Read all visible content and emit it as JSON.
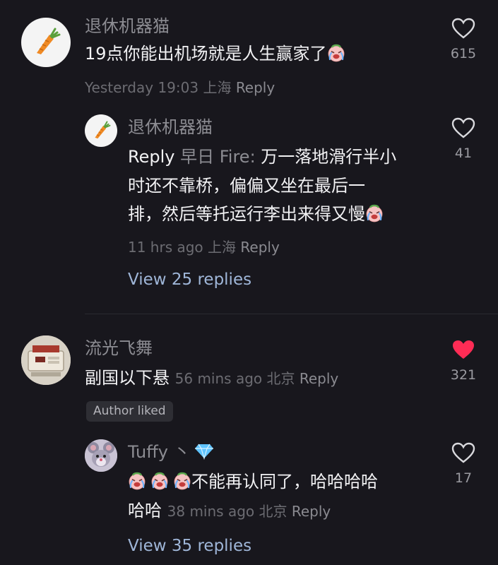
{
  "comments": [
    {
      "username": "退休机器猫",
      "text": "19点你能出机场就是人生赢家了",
      "time": "Yesterday 19:03",
      "location": "上海",
      "reply_label": "Reply",
      "likes": "615",
      "liked": false,
      "avatar": "carrot-icon",
      "replies": [
        {
          "username": "退休机器猫",
          "reply_prefix": "Reply",
          "reply_to": "早日 Fire:",
          "lines": [
            "万一落地滑行半小",
            "时还不靠桥，偏偏又坐在最后一",
            "排，然后等托运行李出来得又慢"
          ],
          "time": "11 hrs ago",
          "location": "上海",
          "reply_label": "Reply",
          "likes": "41",
          "avatar": "carrot-icon"
        }
      ],
      "view_replies": "View 25 replies"
    },
    {
      "username": "流光飞舞",
      "text": "副国以下悬",
      "time": "56 mins ago",
      "location": "北京",
      "reply_label": "Reply",
      "likes": "321",
      "liked": true,
      "liked_color": "#fe2c55",
      "badge": "Author liked",
      "avatar": "console-icon",
      "replies": [
        {
          "username": "Tuffy",
          "name_suffix": "丶",
          "badge_icon": "diamond-icon",
          "lines": [
            "不能再认同了，哈哈哈哈",
            "哈哈"
          ],
          "time": "38 mins ago",
          "location": "北京",
          "reply_label": "Reply",
          "likes": "17",
          "avatar": "mouse-icon"
        }
      ],
      "view_replies": "View 35 replies"
    }
  ],
  "icons": {
    "crying_emoji": "crying-laugh-emoji",
    "heart": "heart-icon"
  }
}
